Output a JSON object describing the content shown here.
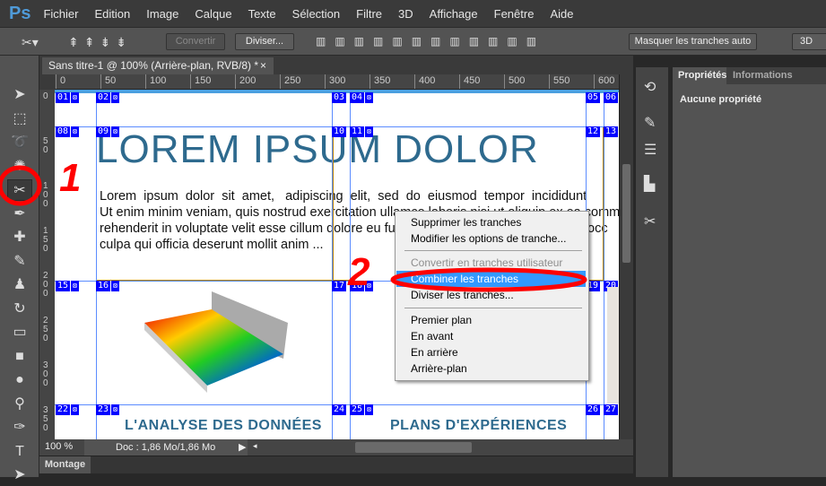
{
  "app": {
    "logo": "Ps"
  },
  "menu": [
    "Fichier",
    "Edition",
    "Image",
    "Calque",
    "Texte",
    "Sélection",
    "Filtre",
    "3D",
    "Affichage",
    "Fenêtre",
    "Aide"
  ],
  "options": {
    "convert": "Convertir",
    "divide": "Diviser...",
    "hide_auto": "Masquer les tranches auto",
    "mode": "3D"
  },
  "document": {
    "tab_title": "Sans titre-1 @ 100% (Arrière-plan, RVB/8) *",
    "close": "×",
    "zoom": "100 %",
    "doc_info": "Doc : 1,86 Mo/1,86 Mo"
  },
  "ruler_top": [
    "0",
    "50",
    "100",
    "150",
    "200",
    "250",
    "300",
    "350",
    "400",
    "450",
    "500",
    "550",
    "600"
  ],
  "ruler_left": [
    "0",
    "50",
    "100",
    "150",
    "200",
    "250",
    "300",
    "350"
  ],
  "slices": [
    "01",
    "02",
    "03",
    "04",
    "05",
    "06",
    "08",
    "09",
    "10",
    "11",
    "12",
    "13",
    "15",
    "16",
    "17",
    "18",
    "19",
    "20",
    "22",
    "23",
    "24",
    "25",
    "26",
    "27"
  ],
  "content": {
    "title": "LOREM IPSUM DOLOR",
    "paragraph": [
      "Lorem  ipsum  dolor  sit  amet,   adipiscing  elit,  sed  do  eiusmod  tempor  incididunt",
      "Ut enim minim veniam, quis nostrud exercitation ullamco laboris nisi ut aliquip ex ea commodo c",
      "rehenderit in voluptate velit esse cillum dolore eu fugiat nulla pariatur. Excepteur sint occ",
      "culpa qui officia deserunt mollit anim ..."
    ],
    "heading1": "L'ANALYSE DES DONNÉES",
    "heading2": "PLANS D'EXPÉRIENCES"
  },
  "context_menu": [
    {
      "label": "Supprimer les tranches",
      "state": "normal"
    },
    {
      "label": "Modifier les options de tranche...",
      "state": "normal"
    },
    {
      "label": "Convertir en tranches utilisateur",
      "state": "disabled"
    },
    {
      "label": "Combiner les tranches",
      "state": "highlighted"
    },
    {
      "label": "Diviser les tranches...",
      "state": "normal"
    },
    {
      "label": "Premier plan",
      "state": "normal"
    },
    {
      "label": "En avant",
      "state": "normal"
    },
    {
      "label": "En arrière",
      "state": "normal"
    },
    {
      "label": "Arrière-plan",
      "state": "normal"
    }
  ],
  "panel": {
    "tabs": [
      "Propriétés",
      "Informations"
    ],
    "content": "Aucune propriété"
  },
  "bottom_panel": {
    "tab": "Montage"
  },
  "annotations": {
    "step1": "1",
    "step2": "2"
  },
  "colors": {
    "accent": "#3399ff",
    "slice": "#0000ff",
    "title": "#2e6a8e",
    "annotation": "#ff0000"
  }
}
